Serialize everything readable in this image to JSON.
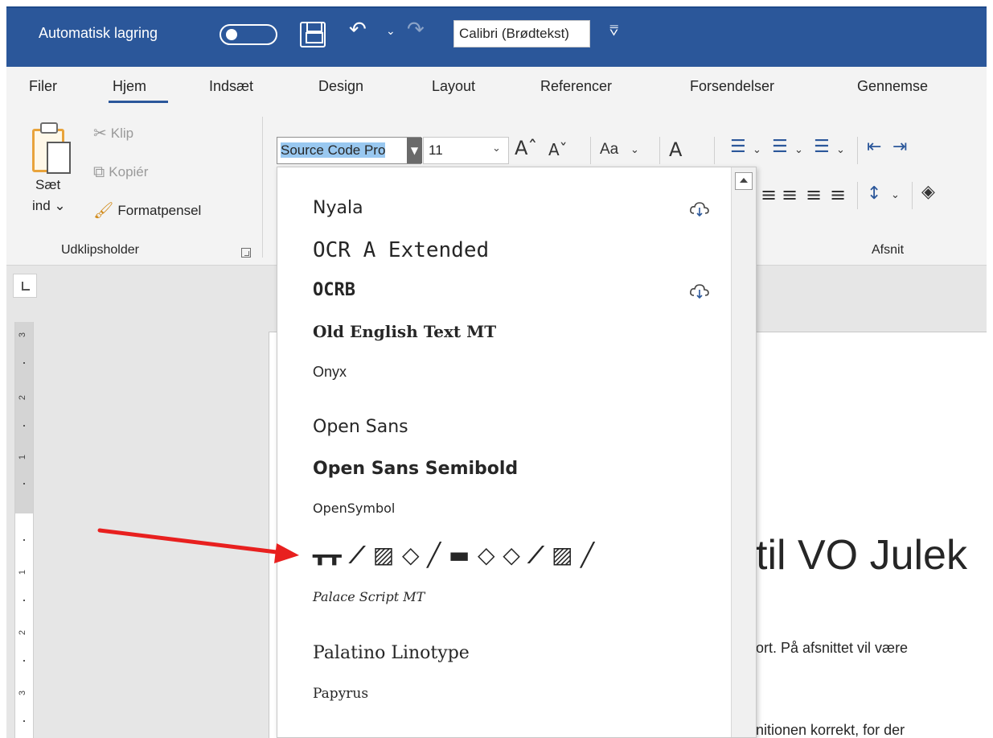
{
  "titlebar": {
    "autosave_label": "Automatisk lagring",
    "font_quick_value": "Calibri (Brødtekst)",
    "more_icon": "⩢"
  },
  "tabs": [
    "Filer",
    "Hjem",
    "Indsæt",
    "Design",
    "Layout",
    "Referencer",
    "Forsendelser",
    "Gennemse"
  ],
  "clipboard": {
    "paste_line1": "Sæt",
    "paste_line2": "ind ⌄",
    "cut": "Klip",
    "copy": "Kopiér",
    "format_painter": "Formatpensel",
    "group_label": "Udklipsholder"
  },
  "font_group": {
    "font_name_selected": "So",
    "font_name_rest": "urce Code Pro",
    "font_size": "11",
    "change_case": "Aa",
    "grow": "Aˆ",
    "shrink": "Aˇ"
  },
  "paragraph": {
    "group_label": "Afsnit"
  },
  "font_list": [
    {
      "name": "Nyala",
      "cloud": true,
      "family": "\"DejaVu Sans\", sans-serif",
      "size": 22,
      "weight": "normal"
    },
    {
      "name": "OCR A Extended",
      "cloud": false,
      "family": "\"DejaVu Sans Mono\", monospace",
      "size": 26,
      "weight": "normal"
    },
    {
      "name": "OCRB",
      "cloud": true,
      "family": "\"DejaVu Sans Mono\", monospace",
      "size": 22,
      "weight": "bold"
    },
    {
      "name": "Old English Text MT",
      "cloud": false,
      "family": "\"DejaVu Serif\", serif",
      "size": 20,
      "weight": "bold"
    },
    {
      "name": "Onyx",
      "cloud": false,
      "family": "\"Liberation Sans\", sans-serif",
      "size": 18,
      "weight": "normal"
    },
    {
      "name": "Open Sans",
      "cloud": false,
      "family": "\"DejaVu Sans\", sans-serif",
      "size": 22,
      "weight": "normal"
    },
    {
      "name": "Open Sans Semibold",
      "cloud": false,
      "family": "\"DejaVu Sans\", sans-serif",
      "size": 22,
      "weight": "bold"
    },
    {
      "name": "OpenSymbol",
      "cloud": false,
      "family": "\"DejaVu Sans\", sans-serif",
      "size": 16,
      "weight": "normal"
    },
    {
      "name": "ᚁᚁ ⟋ ▨ ◇ ╱ ▬ ◇ ◇ ⟋ ▨ ╱",
      "cloud": false,
      "family": "\"DejaVu Sans\", sans-serif",
      "size": 28,
      "weight": "bold"
    },
    {
      "name": "Palace Script MT",
      "cloud": false,
      "family": "\"DejaVu Serif\", serif",
      "size": 16,
      "weight": "normal",
      "italic": true
    },
    {
      "name": "Palatino Linotype",
      "cloud": false,
      "family": "\"DejaVu Serif\", serif",
      "size": 22,
      "weight": "normal"
    },
    {
      "name": "Papyrus",
      "cloud": false,
      "family": "\"DejaVu Serif\", serif",
      "size": 17,
      "weight": "normal"
    }
  ],
  "document": {
    "heading": "til VO Julek",
    "line1": "ort. På afsnittet vil være",
    "line2": "nitionen korrekt, for der"
  },
  "ruler": [
    "3",
    "2",
    "1",
    "1",
    "2",
    "3"
  ],
  "colors": {
    "title_blue": "#2b579a",
    "arrow_red": "#e8201f",
    "selection_blue": "#99c8f0"
  }
}
